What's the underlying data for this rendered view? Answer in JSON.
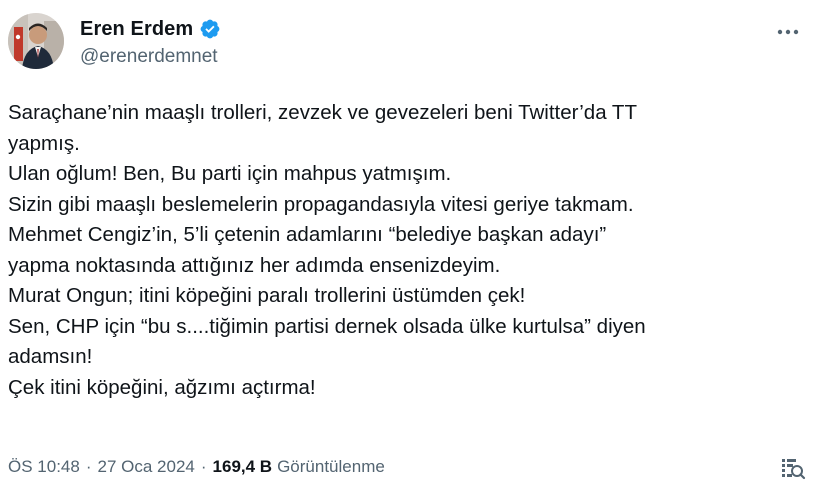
{
  "author": {
    "display_name": "Eren Erdem",
    "handle": "@erenerdemnet",
    "verified": true
  },
  "colors": {
    "verified_badge": "#1d9bf0",
    "secondary_text": "#536471",
    "primary_text": "#0f1419"
  },
  "icons": {
    "more": "more-icon",
    "verified": "verified-badge-icon",
    "analytics": "analytics-icon"
  },
  "tweet_lines": [
    "Saraçhane’nin maaşlı trolleri, zevzek ve gevezeleri beni Twitter’da TT",
    "yapmış.",
    "Ulan oğlum! Ben, Bu parti için mahpus yatmışım.",
    "Sizin gibi maaşlı beslemelerin propagandasıyla vitesi geriye takmam.",
    "Mehmet Cengiz’in, 5’li çetenin adamlarını “belediye başkan adayı”",
    "yapma noktasında attığınız her adımda ensenizdeyim.",
    "Murat Ongun; itini köpeğini paralı trollerini üstümden çek!",
    "Sen, CHP için “bu s....tiğimin partisi dernek olsada ülke kurtulsa” diyen",
    "adamsın!",
    "Çek itini köpeğini, ağzımı açtırma!"
  ],
  "meta": {
    "time": "ÖS 10:48",
    "date": "27 Oca 2024",
    "separator": "·",
    "views_count": "169,4 B",
    "views_label": "Görüntülenme"
  }
}
